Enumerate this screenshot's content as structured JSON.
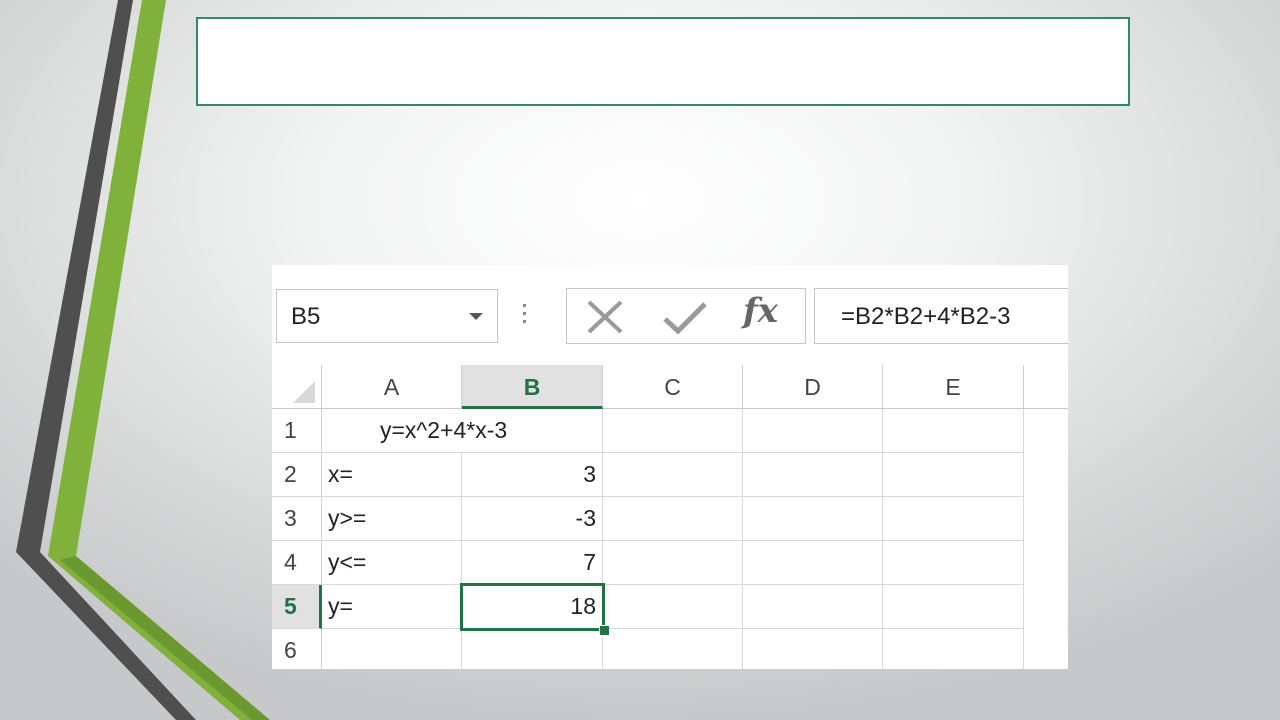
{
  "slide": {
    "title": "",
    "colors": {
      "accent_green": "#7fb03a",
      "dark_bar": "#4a4a4a",
      "title_border": "#2e8b64"
    }
  },
  "spreadsheet": {
    "name_box": "B5",
    "formula": "=B2*B2+4*B2-3",
    "icons": {
      "cancel": "x-icon",
      "enter": "checkmark-icon",
      "function": "fx-icon"
    },
    "fx_label": "fx",
    "columns": [
      "A",
      "B",
      "C",
      "D",
      "E"
    ],
    "rows": [
      "1",
      "2",
      "3",
      "4",
      "5",
      "6"
    ],
    "selected_column": "B",
    "selected_row": "5",
    "cells": {
      "A1": "y=x^2+4*x-3",
      "A2": "x=",
      "B2": "3",
      "A3": "y>=",
      "B3": "-3",
      "A4": "y<=",
      "B4": "7",
      "A5": "y=",
      "B5": "18"
    },
    "accent_color": "#217346"
  }
}
